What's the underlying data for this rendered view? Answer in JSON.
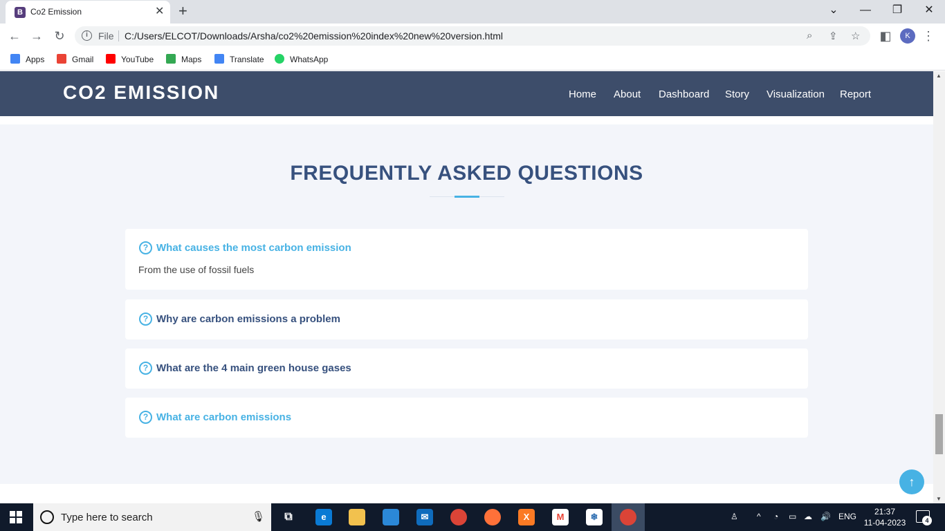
{
  "browser": {
    "tab_title": "Co2 Emission",
    "tab_favicon_letter": "B",
    "address_scheme_label": "File",
    "url": "C:/Users/ELCOT/Downloads/Arsha/co2%20emission%20index%20new%20version.html",
    "profile_initial": "K",
    "bookmarks": [
      {
        "label": "Apps",
        "icon": "apps-grid-icon",
        "color": "#4285f4"
      },
      {
        "label": "Gmail",
        "icon": "gmail-icon",
        "color": "#ea4335"
      },
      {
        "label": "YouTube",
        "icon": "youtube-icon",
        "color": "#ff0000"
      },
      {
        "label": "Maps",
        "icon": "maps-icon",
        "color": "#34a853"
      },
      {
        "label": "Translate",
        "icon": "translate-icon",
        "color": "#4285f4"
      },
      {
        "label": "WhatsApp",
        "icon": "whatsapp-icon",
        "color": "#25d366"
      }
    ]
  },
  "site": {
    "logo": "CO2 EMISSION",
    "nav": [
      "Home",
      "About",
      "Dashboard",
      "Story",
      "Visualization",
      "Report"
    ],
    "colors": {
      "header": "#3d4d6a",
      "accent": "#47b2e4",
      "heading": "#37517e"
    }
  },
  "faq": {
    "title": "FREQUENTLY ASKED QUESTIONS",
    "items": [
      {
        "question": "What causes the most carbon emission",
        "answer": "From the use of fossil fuels",
        "expanded": true
      },
      {
        "question": "Why are carbon emissions a problem",
        "expanded": false
      },
      {
        "question": "What are the 4 main green house gases",
        "expanded": false
      },
      {
        "question": "What are carbon emissions",
        "expanded": false
      }
    ]
  },
  "taskbar": {
    "search_placeholder": "Type here to search",
    "language": "ENG",
    "time": "21:37",
    "date": "11-04-2023",
    "notification_count": "4"
  }
}
